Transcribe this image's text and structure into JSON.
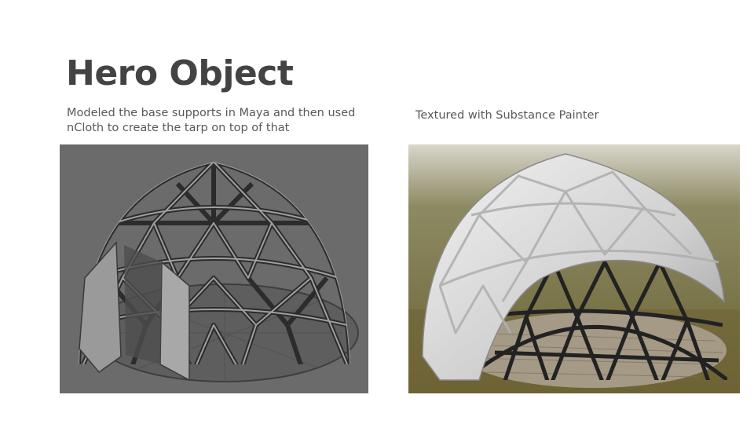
{
  "slide": {
    "title": "Hero Object",
    "left_caption": "Modeled the base supports in Maya and then used nCloth to create the tarp on top of that",
    "right_caption": "Textured with Substance Painter"
  }
}
